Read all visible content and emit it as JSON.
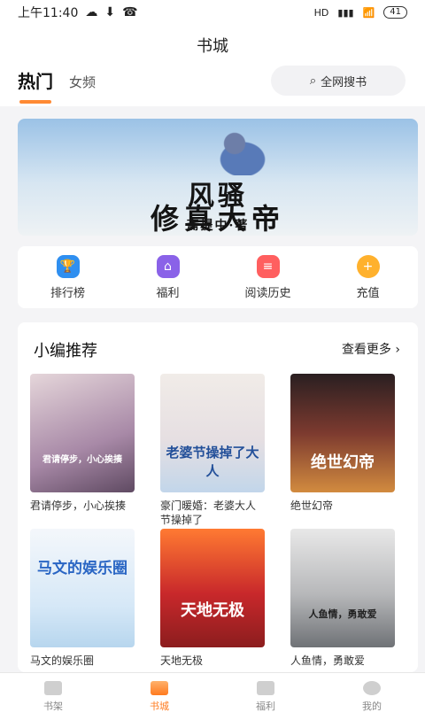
{
  "status": {
    "time": "上午11:40",
    "battery": "41",
    "signal": "HD",
    "icons": [
      "cloud-icon",
      "download-icon",
      "phone-icon",
      "signal-icon",
      "wifi-icon"
    ]
  },
  "header": {
    "title": "书城",
    "tabs": [
      "热门",
      "女频"
    ],
    "search_label": "全网搜书"
  },
  "banner": {
    "line1": "风骚",
    "line2": "修真大帝",
    "line3": "斋提中·著"
  },
  "quick_links": [
    {
      "label": "排行榜",
      "icon": "trophy-icon"
    },
    {
      "label": "福利",
      "icon": "gift-icon"
    },
    {
      "label": "阅读历史",
      "icon": "history-icon"
    },
    {
      "label": "充值",
      "icon": "coin-icon"
    }
  ],
  "recommend": {
    "title": "小编推荐",
    "more_label": "查看更多",
    "books": [
      {
        "title": "君请停步，小心挨揍",
        "cover_text": "君请停步，小心挨揍"
      },
      {
        "title": "豪门暖婚：老婆大人节操掉了",
        "cover_text": "老婆节操掉了大人"
      },
      {
        "title": "绝世幻帝",
        "cover_text": "绝世幻帝"
      },
      {
        "title": "马文的娱乐圈",
        "cover_text": "马文的娱乐圈"
      },
      {
        "title": "天地无极",
        "cover_text": "天地无极"
      },
      {
        "title": "人鱼情，勇敢爱",
        "cover_text": "人鱼情，勇敢爱"
      }
    ]
  },
  "bottom_nav": [
    {
      "label": "书架"
    },
    {
      "label": "书城",
      "active": true
    },
    {
      "label": "福利"
    },
    {
      "label": "我的"
    }
  ],
  "colors": {
    "accent": "#ff7b1f",
    "background": "#f4f4f6"
  }
}
